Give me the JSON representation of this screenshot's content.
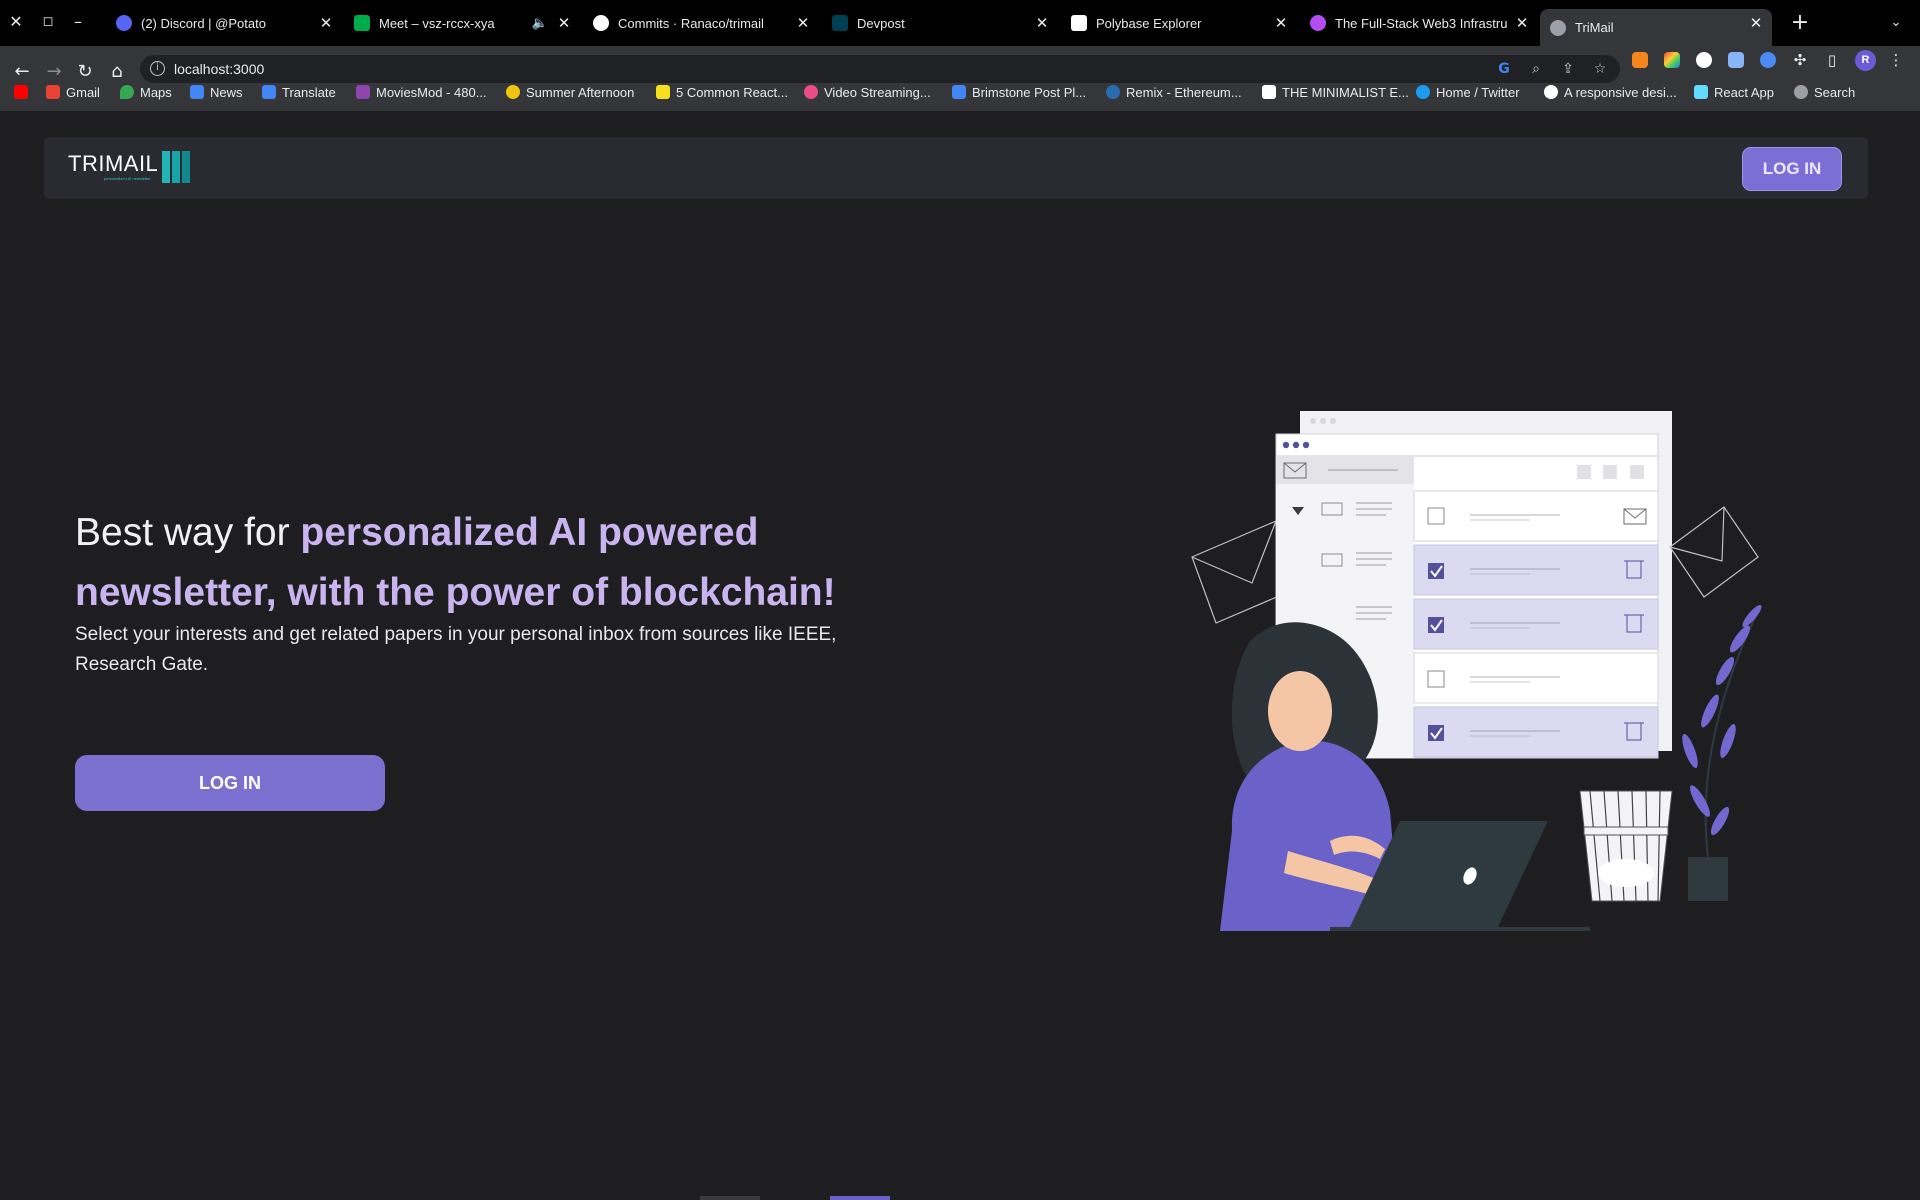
{
  "browser": {
    "tabs": [
      {
        "title": "(2) Discord | @Potato",
        "favicon_color": "#5865f2"
      },
      {
        "title": "Meet – vsz-rccx-xya",
        "favicon_color": "#00ac47"
      },
      {
        "title": "Commits · Ranaco/trimail",
        "favicon_color": "#ffffff"
      },
      {
        "title": "Devpost",
        "favicon_color": "#003e54"
      },
      {
        "title": "Polybase Explorer",
        "favicon_color": "#ffffff"
      },
      {
        "title": "The Full-Stack Web3 Infrastru",
        "favicon_color": "#b44cf0"
      },
      {
        "title": "TriMail",
        "favicon_color": "#9aa0a6"
      }
    ],
    "url": "localhost:3000",
    "profile_initial": "R",
    "bookmarks": [
      {
        "label": "",
        "color": "#ff0000"
      },
      {
        "label": "Gmail",
        "color": "#ea4335"
      },
      {
        "label": "Maps",
        "color": "#34a853"
      },
      {
        "label": "News",
        "color": "#4285f4"
      },
      {
        "label": "Translate",
        "color": "#4285f4"
      },
      {
        "label": "MoviesMod - 480...",
        "color": "#8e44ad"
      },
      {
        "label": "Summer Afternoon",
        "color": "#f1c40f"
      },
      {
        "label": "5 Common React...",
        "color": "#f7df1e"
      },
      {
        "label": "Video Streaming...",
        "color": "#ea4c89"
      },
      {
        "label": "Brimstone Post Pl...",
        "color": "#4285f4"
      },
      {
        "label": "Remix - Ethereum...",
        "color": "#2b6cb0"
      },
      {
        "label": "THE MINIMALIST E...",
        "color": "#ffffff"
      },
      {
        "label": "Home / Twitter",
        "color": "#1d9bf0"
      },
      {
        "label": "A responsive desi...",
        "color": "#ffffff"
      },
      {
        "label": "React App",
        "color": "#61dafb"
      },
      {
        "label": "Search",
        "color": "#9aa0a6"
      }
    ]
  },
  "navbar": {
    "logo_text": "TRIMAIL",
    "logo_tagline": "personalized AI newsletter",
    "login_label": "LOG IN"
  },
  "hero": {
    "title_plain": "Best way for ",
    "title_highlight": "personalized AI powered newsletter, with the power of blockchain!",
    "subtitle": "Select your interests and get related papers in your personal inbox from sources like IEEE, Research Gate.",
    "login_label": "LOG IN"
  },
  "colors": {
    "page_bg": "#1e1e21",
    "navbar_bg": "#2a2b31",
    "accent": "#7b70d0",
    "highlight_text": "#c9b4f0",
    "logo_teal": "#22b3b3"
  }
}
